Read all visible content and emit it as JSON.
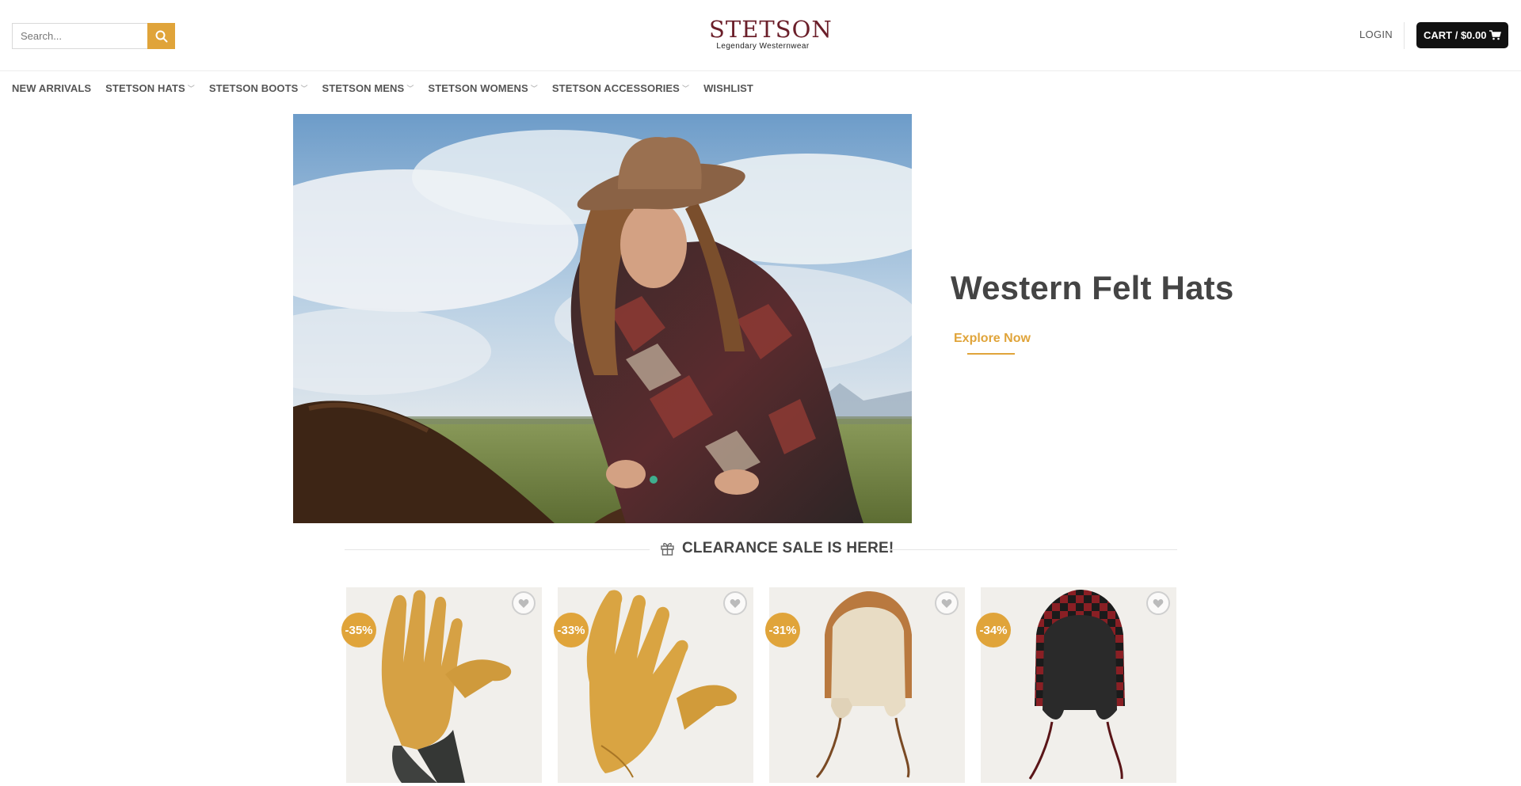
{
  "header": {
    "search_placeholder": "Search...",
    "logo_main": "STETSON",
    "logo_sub": "Legendary Westernwear",
    "login_label": "LOGIN",
    "cart_label": "CART / $0.00"
  },
  "nav": {
    "items": [
      {
        "label": "NEW ARRIVALS",
        "dropdown": false
      },
      {
        "label": "STETSON HATS",
        "dropdown": true
      },
      {
        "label": "STETSON BOOTS",
        "dropdown": true
      },
      {
        "label": "STETSON MENS",
        "dropdown": true
      },
      {
        "label": "STETSON WOMENS",
        "dropdown": true
      },
      {
        "label": "STETSON ACCESSORIES",
        "dropdown": true
      },
      {
        "label": "WISHLIST",
        "dropdown": false
      }
    ]
  },
  "hero": {
    "title": "Western Felt Hats",
    "cta": "Explore Now"
  },
  "section": {
    "title": "CLEARANCE SALE IS HERE!"
  },
  "products": [
    {
      "badge": "-35%",
      "kind": "glove-cuffed"
    },
    {
      "badge": "-33%",
      "kind": "glove"
    },
    {
      "badge": "-31%",
      "kind": "trapper-tan"
    },
    {
      "badge": "-34%",
      "kind": "trapper-plaid"
    }
  ],
  "colors": {
    "accent": "#e0a43a",
    "logo": "#6b1f2a",
    "cart_bg": "#111111"
  },
  "icons": [
    "search-icon",
    "cart-icon",
    "gift-icon",
    "heart-icon",
    "chevron-down-icon"
  ]
}
